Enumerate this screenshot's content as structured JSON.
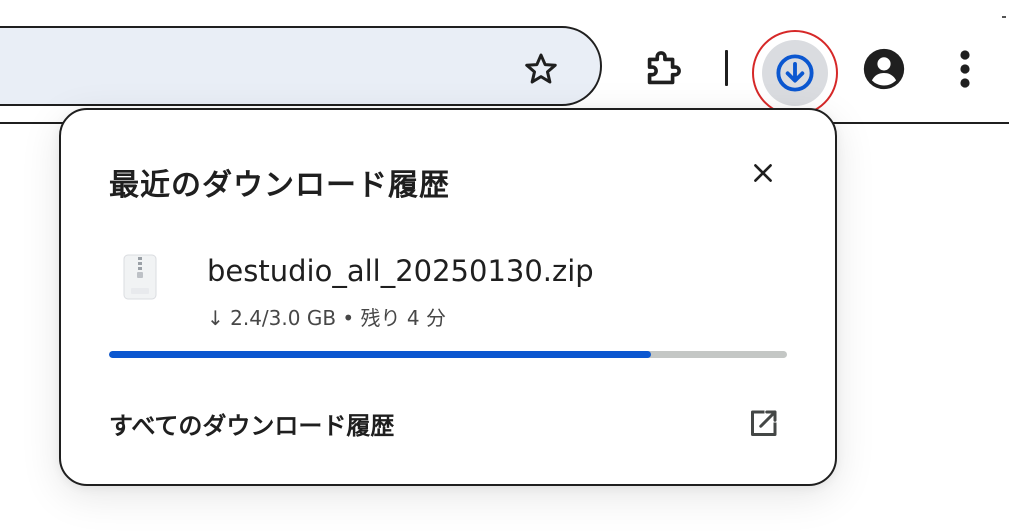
{
  "toolbar": {
    "icons": {
      "bookmark": "star-icon",
      "extensions": "puzzle-icon",
      "downloads": "download-icon",
      "profile": "account-icon",
      "menu": "kebab-menu-icon"
    }
  },
  "popup": {
    "title": "最近のダウンロード履歴",
    "close_icon": "close-icon",
    "download": {
      "file_name": "bestudio_all_20250130.zip",
      "status": "↓ 2.4/3.0 GB • 残り 4 分",
      "progress": 0.8,
      "file_icon": "zip-file-icon"
    },
    "all_downloads_label": "すべてのダウンロード履歴",
    "open_icon": "open-in-new-icon"
  },
  "colors": {
    "accent": "#0b57d0",
    "highlight_ring": "#d62828",
    "omnibox_bg": "#e9eef6",
    "track": "#c4c7c5"
  }
}
